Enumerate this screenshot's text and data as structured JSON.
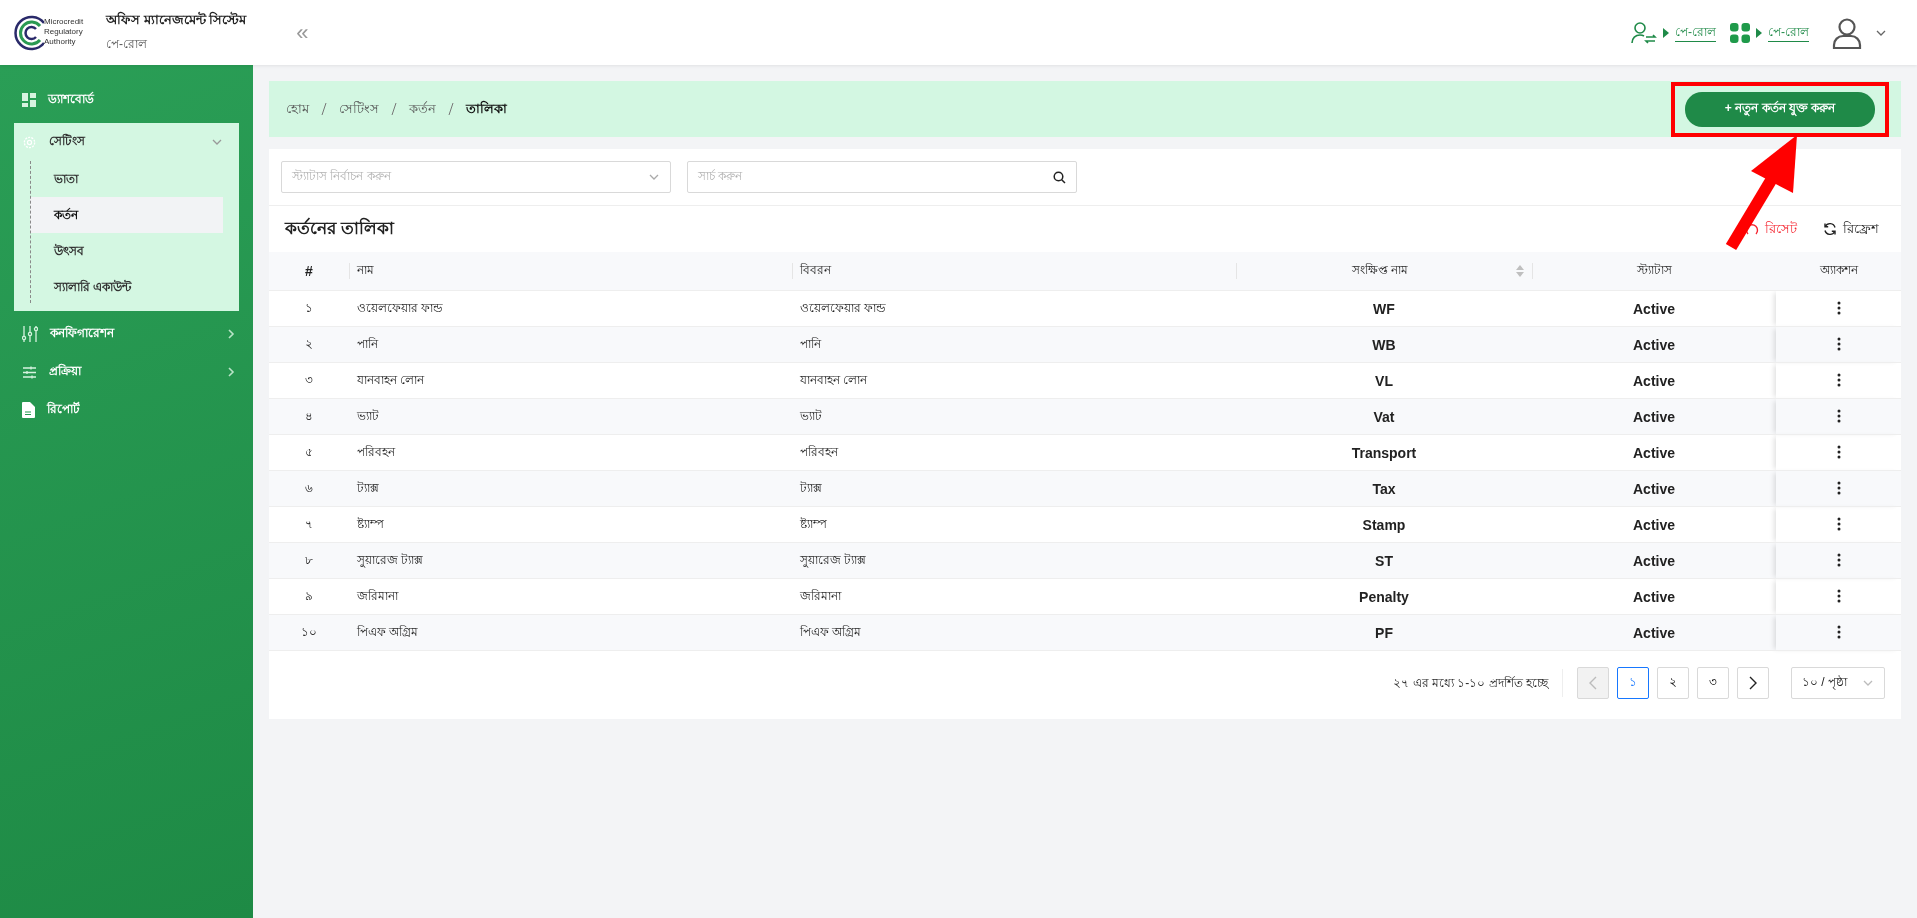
{
  "header": {
    "logo_text": [
      "Microcredit",
      "Regulatory",
      "Authority"
    ],
    "title": "অফিস ম্যানেজমেন্ট সিস্টেম",
    "subtitle": "পে-রোল",
    "collapse": "«",
    "links": [
      {
        "kind": "user-switch",
        "label": "পে-রোল"
      },
      {
        "kind": "apps",
        "label": "পে-রোল"
      }
    ]
  },
  "sidebar": {
    "items": [
      {
        "kind": "dashboard",
        "label": "ড্যাশবোর্ড"
      },
      {
        "kind": "settings",
        "label": "সেটিংস",
        "expanded": true,
        "children": [
          {
            "label": "ভাতা",
            "selected": false
          },
          {
            "label": "কর্তন",
            "selected": true
          },
          {
            "label": "উৎসব",
            "selected": false
          },
          {
            "label": "স্যালারি একাউন্ট",
            "selected": false
          }
        ]
      },
      {
        "kind": "configuration",
        "label": "কনফিগারেশন",
        "expanded": false
      },
      {
        "kind": "process",
        "label": "প্রক্রিয়া",
        "expanded": false
      },
      {
        "kind": "report",
        "label": "রিপোর্ট"
      }
    ]
  },
  "breadcrumb": [
    "হোম",
    "সেটিংস",
    "কর্তন",
    "তালিকা"
  ],
  "add_button": "+ নতুন কর্তন যুক্ত করুন",
  "filters": {
    "status_select": {
      "placeholder": "স্ট্যাটাস নির্বাচন করুন"
    },
    "search": {
      "placeholder": "সার্চ করুন"
    }
  },
  "table": {
    "title": "কর্তনের তালিকা",
    "tools": [
      {
        "kind": "reset",
        "label": "রিসেট"
      },
      {
        "kind": "refresh",
        "label": "রিফ্রেশ"
      }
    ],
    "columns": [
      {
        "label": "#",
        "sortable": false
      },
      {
        "label": "নাম",
        "sortable": false
      },
      {
        "label": "বিবরন",
        "sortable": false
      },
      {
        "label": "সংক্ষিপ্ত নাম",
        "sortable": true
      },
      {
        "label": "স্ট্যাটাস",
        "sortable": false
      },
      {
        "label": "অ্যাকশন",
        "sortable": false
      }
    ],
    "rows": [
      [
        "১",
        "ওয়েলফেয়ার ফান্ড",
        "ওয়েলফেয়ার ফান্ড",
        "WF",
        "Active"
      ],
      [
        "২",
        "পানি",
        "পানি",
        "WB",
        "Active"
      ],
      [
        "৩",
        "যানবাহন লোন",
        "যানবাহন লোন",
        "VL",
        "Active"
      ],
      [
        "৪",
        "ভ্যাট",
        "ভ্যাট",
        "Vat",
        "Active"
      ],
      [
        "৫",
        "পরিবহন",
        "পরিবহন",
        "Transport",
        "Active"
      ],
      [
        "৬",
        "ট্যাক্স",
        "ট্যাক্স",
        "Tax",
        "Active"
      ],
      [
        "৭",
        "ষ্ট্যাম্প",
        "ষ্ট্যাম্প",
        "Stamp",
        "Active"
      ],
      [
        "৮",
        "সুয়ারেজ ট্যাক্স",
        "সুয়ারেজ ট্যাক্স",
        "ST",
        "Active"
      ],
      [
        "৯",
        "জরিমানা",
        "জরিমানা",
        "Penalty",
        "Active"
      ],
      [
        "১০",
        "পিএফ অগ্রিম",
        "পিএফ অগ্রিম",
        "PF",
        "Active"
      ]
    ]
  },
  "pagination": {
    "summary": "২৭ এর মধ্যে ১-১০ প্রদর্শিত হচ্ছে",
    "prev_disabled": true,
    "next_disabled": false,
    "pages": [
      {
        "label": "১",
        "selected": true
      },
      {
        "label": "২",
        "selected": false
      },
      {
        "label": "৩",
        "selected": false
      }
    ],
    "page_size": "১০ / পৃষ্ঠা"
  }
}
